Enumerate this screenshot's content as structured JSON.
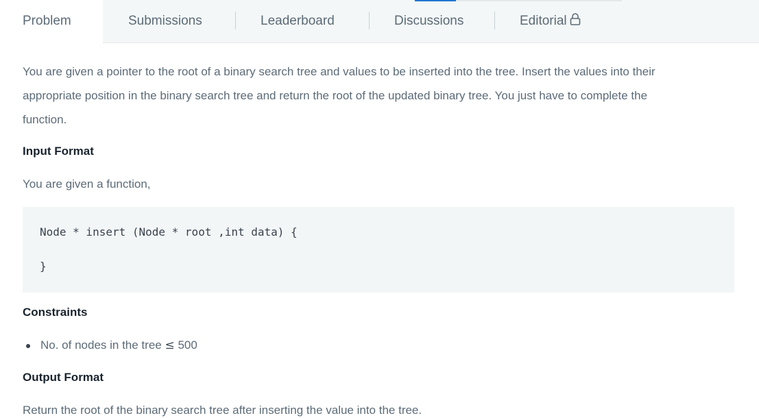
{
  "tabs": [
    {
      "label": "Problem",
      "active": true
    },
    {
      "label": "Submissions",
      "active": false
    },
    {
      "label": "Leaderboard",
      "active": false
    },
    {
      "label": "Discussions",
      "active": false
    },
    {
      "label": "Editorial",
      "active": false,
      "icon": "lock-icon"
    }
  ],
  "colors": {
    "accent": "#1ba94c",
    "tabbar_bg": "#f3f7f7",
    "code_bg": "#f3f6f7",
    "heading": "#1a242d",
    "body_text": "#5c6b77"
  },
  "problem": {
    "intro_line1": "You are given a pointer to the root of a binary search tree and values to be inserted into the tree. Insert the values into their",
    "intro_line2": "appropriate position in the binary search tree and return the root of the updated binary tree. You just have to complete the",
    "intro_line3": "function.",
    "input_heading": "Input Format",
    "input_text": "You are given a function,",
    "code_line1": "Node * insert (Node * root ,int data) {",
    "code_line2": "}",
    "constraints_heading": "Constraints",
    "constraint_1_text": "No. of nodes in the tree",
    "constraint_1_op": "≤",
    "constraint_1_value": "500",
    "output_heading": "Output Format",
    "output_text": "Return the root of the binary search tree after inserting the value into the tree."
  }
}
